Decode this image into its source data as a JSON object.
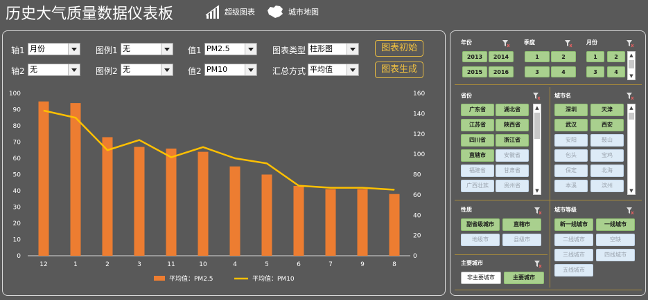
{
  "header": {
    "title": "历史大气质量数据仪表板",
    "super_chart_label": "超级图表",
    "city_map_label": "城市地图"
  },
  "controls": {
    "axis1_label": "轴1",
    "axis1_value": "月份",
    "axis2_label": "轴2",
    "axis2_value": "无",
    "legend1_label": "图例1",
    "legend1_value": "无",
    "legend2_label": "图例2",
    "legend2_value": "无",
    "value1_label": "值1",
    "value1_value": "PM2.5",
    "value2_label": "值2",
    "value2_value": "PM10",
    "chart_type_label": "图表类型",
    "chart_type_value": "柱形图",
    "agg_label": "汇总方式",
    "agg_value": "平均值",
    "init_button": "图表初始",
    "generate_button": "图表生成"
  },
  "chart_data": {
    "type": "bar",
    "categories": [
      "12",
      "1",
      "2",
      "3",
      "11",
      "10",
      "4",
      "5",
      "6",
      "7",
      "9",
      "8"
    ],
    "series": [
      {
        "name": "平均值：PM2.5",
        "type": "bar",
        "axis": "left",
        "color": "#ed7d31",
        "values": [
          95,
          94,
          73,
          67,
          66,
          64,
          55,
          50,
          43,
          41,
          41,
          38
        ]
      },
      {
        "name": "平均值：PM10",
        "type": "line",
        "axis": "right",
        "color": "#ffc000",
        "values": [
          143,
          136,
          104,
          114,
          97,
          107,
          96,
          91,
          69,
          67,
          67,
          65
        ]
      }
    ],
    "y_left": {
      "ylim": [
        0,
        100
      ],
      "ticks": [
        0,
        10,
        20,
        30,
        40,
        50,
        60,
        70,
        80,
        90,
        100
      ]
    },
    "y_right": {
      "ylim": [
        0,
        160
      ],
      "ticks": [
        0,
        20,
        40,
        60,
        80,
        100,
        120,
        140,
        160
      ]
    },
    "legend_position": "bottom",
    "grid": false
  },
  "slicers": {
    "year": {
      "title": "年份",
      "items": [
        "2013",
        "2014",
        "2015",
        "2016"
      ]
    },
    "quarter": {
      "title": "季度",
      "items": [
        "1",
        "2",
        "3",
        "4"
      ]
    },
    "month": {
      "title": "月份",
      "items": [
        "1",
        "2",
        "3",
        "4"
      ]
    },
    "province": {
      "title": "省份",
      "selected": [
        "广东省",
        "湖北省",
        "江苏省",
        "陕西省",
        "四川省",
        "浙江省",
        "直辖市"
      ],
      "unselected": [
        "安徽省",
        "福建省",
        "甘肃省",
        "广西壮族",
        "贵州省"
      ]
    },
    "city": {
      "title": "城市名",
      "selected": [
        "深圳",
        "天津",
        "武汉",
        "西安"
      ],
      "unselected": [
        "安阳",
        "鞍山",
        "包头",
        "宝鸡",
        "保定",
        "北海",
        "本溪",
        "滨州"
      ]
    },
    "nature": {
      "title": "性质",
      "selected": [
        "副省级城市",
        "直辖市"
      ],
      "unselected": [
        "地级市",
        "县级市"
      ]
    },
    "city_level": {
      "title": "城市等级",
      "selected": [
        "新一线城市",
        "一线城市"
      ],
      "unselected": [
        "二线城市",
        "三线城市",
        "四线城市",
        "五线城市",
        "空缺"
      ]
    },
    "major_city": {
      "title": "主要城市",
      "items": [
        "非主要城市",
        "主要城市"
      ]
    }
  }
}
